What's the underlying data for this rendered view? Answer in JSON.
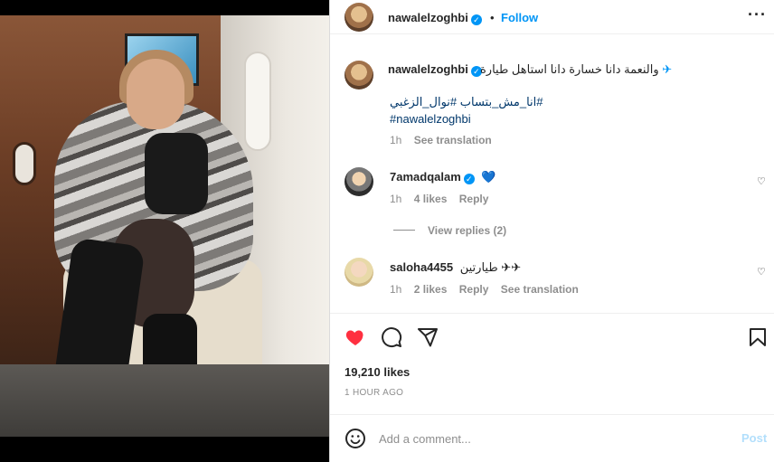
{
  "header": {
    "username": "nawalelzoghbi",
    "verified_icon": "verified-badge-icon",
    "separator": "•",
    "follow_label": "Follow",
    "more_icon": "more-options-icon"
  },
  "caption": {
    "username": "nawalelzoghbi",
    "text": "والنعمة دانا خسارة دانا استاهل طيارة",
    "emoji": "✈",
    "hashtags_line1": "#انا_مش_بتساب #نوال_الزغبي",
    "hashtags_line2": "#nawalelzoghbi",
    "time": "1h",
    "see_translation": "See translation"
  },
  "comments": [
    {
      "username": "7amadqalam",
      "text": "💙",
      "time": "1h",
      "likes": "4 likes",
      "reply": "Reply"
    },
    {
      "username": "saloha4455",
      "text": "طيارتين ✈✈",
      "time": "1h",
      "likes": "2 likes",
      "reply": "Reply",
      "see_translation": "See translation"
    }
  ],
  "view_replies": "View replies (2)",
  "actions": {
    "like_icon": "heart-filled-icon",
    "comment_icon": "comment-icon",
    "share_icon": "share-icon",
    "save_icon": "bookmark-icon"
  },
  "likes_count": "19,210 likes",
  "post_time": "1 HOUR AGO",
  "comment_box": {
    "emoji_icon": "emoji-icon",
    "placeholder": "Add a comment...",
    "post_label": "Post"
  },
  "colors": {
    "accent": "#0095f6",
    "like": "#ff3040",
    "hashtag": "#00376b",
    "muted": "#8e8e8e"
  }
}
